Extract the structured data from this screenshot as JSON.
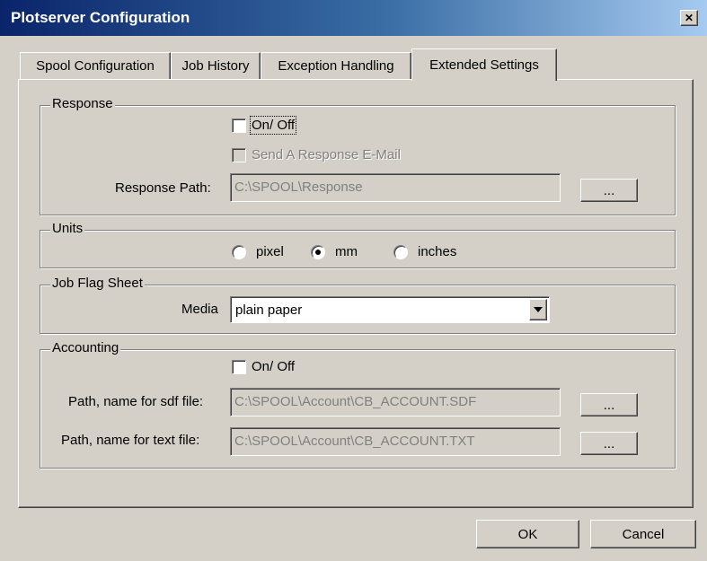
{
  "window": {
    "title": "Plotserver Configuration",
    "close_glyph": "✕"
  },
  "tabs": [
    {
      "label": "Spool Configuration",
      "active": false
    },
    {
      "label": "Job History",
      "active": false
    },
    {
      "label": "Exception Handling",
      "active": false
    },
    {
      "label": "Extended Settings",
      "active": true
    }
  ],
  "response": {
    "group_label": "Response",
    "onoff_label": "On/ Off",
    "onoff_checked": false,
    "email_label": "Send A Response E-Mail",
    "email_checked": false,
    "path_label": "Response Path:",
    "path_value": "C:\\SPOOL\\Response",
    "browse_label": "..."
  },
  "units": {
    "group_label": "Units",
    "options": [
      {
        "label": "pixel",
        "selected": false
      },
      {
        "label": "mm",
        "selected": true
      },
      {
        "label": "inches",
        "selected": false
      }
    ]
  },
  "job_flag_sheet": {
    "group_label": "Job Flag Sheet",
    "media_label": "Media",
    "media_value": "plain paper"
  },
  "accounting": {
    "group_label": "Accounting",
    "onoff_label": "On/ Off",
    "onoff_checked": false,
    "sdf_label": "Path, name for sdf file:",
    "sdf_value": "C:\\SPOOL\\Account\\CB_ACCOUNT.SDF",
    "txt_label": "Path, name for text file:",
    "txt_value": "C:\\SPOOL\\Account\\CB_ACCOUNT.TXT",
    "browse_label": "..."
  },
  "buttons": {
    "ok": "OK",
    "cancel": "Cancel"
  }
}
